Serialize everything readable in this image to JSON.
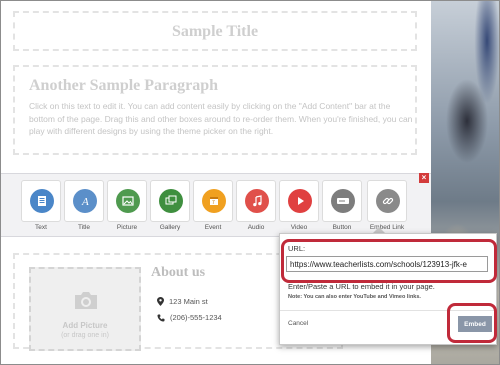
{
  "page": {
    "title": "Sample Title",
    "paragraph_heading": "Another Sample Paragraph",
    "paragraph_body": "Click on this text to edit it. You can add content easily by clicking on the \"Add Content\" bar at the bottom of the page. Drag this and other boxes around to re-order them. When you're finished, you can play with different designs by using the theme picker on the right."
  },
  "toolbar": {
    "close_glyph": "×",
    "items": [
      {
        "label": "Text",
        "color": "#4a86c8",
        "icon": "text-doc-icon"
      },
      {
        "label": "Title",
        "color": "#5b8fc9",
        "icon": "title-a-icon"
      },
      {
        "label": "Picture",
        "color": "#4f9a4f",
        "icon": "picture-icon"
      },
      {
        "label": "Gallery",
        "color": "#3f8f3f",
        "icon": "gallery-icon"
      },
      {
        "label": "Event",
        "color": "#f0a020",
        "icon": "calendar-icon"
      },
      {
        "label": "Audio",
        "color": "#e0504a",
        "icon": "music-note-icon"
      },
      {
        "label": "Video",
        "color": "#e04040",
        "icon": "play-icon"
      },
      {
        "label": "Button",
        "color": "#7d7d7d",
        "icon": "button-icon"
      },
      {
        "label": "Embed Link",
        "color": "#8a8a8a",
        "icon": "link-icon"
      }
    ]
  },
  "about": {
    "title": "About us",
    "add_picture": "Add Picture",
    "drag_hint": "(or drag one in)",
    "address": "123 Main st",
    "phone": "(206)-555-1234"
  },
  "embed_popup": {
    "url_label": "URL:",
    "url_value": "https://www.teacherlists.com/schools/123913-jfk-e",
    "hint": "Enter/Paste a URL to embed it in your page.",
    "note": "Note: You can also enter YouTube and Vimeo links.",
    "cancel_label": "Cancel",
    "embed_label": "Embed"
  },
  "colors": {
    "highlight": "#c02a3a",
    "embed_button": "#8a96a8"
  }
}
